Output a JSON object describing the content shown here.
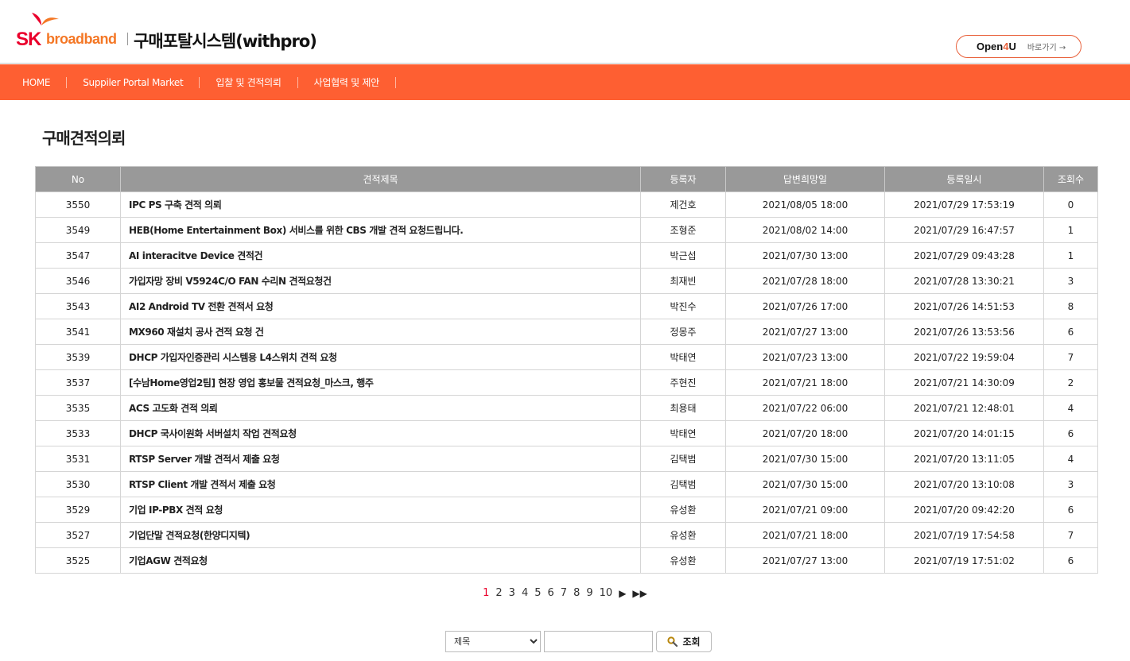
{
  "header": {
    "logo_sk": "SK",
    "logo_broadband": "broadband",
    "site_title": "구매포탈시스템(withpro)",
    "open4u_prefix": "Open",
    "open4u_num": "4",
    "open4u_suffix": "U",
    "open4u_go": "바로가기 →"
  },
  "nav": [
    {
      "label": "HOME"
    },
    {
      "label": "Suppiler Portal Market"
    },
    {
      "label": "입찰 및 견적의뢰"
    },
    {
      "label": "사업협력 및 제안"
    }
  ],
  "page_title": "구매견적의뢰",
  "table": {
    "headers": [
      "No",
      "견적제목",
      "등록자",
      "답변희망일",
      "등록일시",
      "조회수"
    ],
    "rows": [
      [
        "3550",
        "IPC PS 구축 견적 의뢰",
        "제건호",
        "2021/08/05 18:00",
        "2021/07/29 17:53:19",
        "0"
      ],
      [
        "3549",
        "HEB(Home Entertainment Box) 서비스를 위한 CBS 개발 견적 요청드립니다.",
        "조형준",
        "2021/08/02 14:00",
        "2021/07/29 16:47:57",
        "1"
      ],
      [
        "3547",
        "AI interacitve Device 견적건",
        "박근섭",
        "2021/07/30 13:00",
        "2021/07/29 09:43:28",
        "1"
      ],
      [
        "3546",
        "가입자망 장비 V5924C/O FAN 수리N 견적요청건",
        "최재빈",
        "2021/07/28 18:00",
        "2021/07/28 13:30:21",
        "3"
      ],
      [
        "3543",
        "AI2 Android TV 전환 견적서 요청",
        "박진수",
        "2021/07/26 17:00",
        "2021/07/26 14:51:53",
        "8"
      ],
      [
        "3541",
        "MX960 재설치 공사 견적 요청 건",
        "정몽주",
        "2021/07/27 13:00",
        "2021/07/26 13:53:56",
        "6"
      ],
      [
        "3539",
        "DHCP 가입자인증관리 시스템용 L4스위치 견적 요청",
        "박태연",
        "2021/07/23 13:00",
        "2021/07/22 19:59:04",
        "7"
      ],
      [
        "3537",
        "[수남Home영업2팀] 현장 영업 홍보물 견적요청_마스크, 행주",
        "주현진",
        "2021/07/21 18:00",
        "2021/07/21 14:30:09",
        "2"
      ],
      [
        "3535",
        "ACS 고도화 견적 의뢰",
        "최용태",
        "2021/07/22 06:00",
        "2021/07/21 12:48:01",
        "4"
      ],
      [
        "3533",
        "DHCP 국사이원화 서버설치 작업 견적요청",
        "박태연",
        "2021/07/20 18:00",
        "2021/07/20 14:01:15",
        "6"
      ],
      [
        "3531",
        "RTSP Server 개발 견적서 제출 요청",
        "김택범",
        "2021/07/30 15:00",
        "2021/07/20 13:11:05",
        "4"
      ],
      [
        "3530",
        "RTSP Client 개발 견적서 제출 요청",
        "김택범",
        "2021/07/30 15:00",
        "2021/07/20 13:10:08",
        "3"
      ],
      [
        "3529",
        "기업 IP-PBX 견적 요청",
        "유성환",
        "2021/07/21 09:00",
        "2021/07/20 09:42:20",
        "6"
      ],
      [
        "3527",
        "기업단말 견적요청(한양디지텍)",
        "유성환",
        "2021/07/21 18:00",
        "2021/07/19 17:54:58",
        "7"
      ],
      [
        "3525",
        "기업AGW 견적요청",
        "유성환",
        "2021/07/27 13:00",
        "2021/07/19 17:51:02",
        "6"
      ]
    ]
  },
  "pagination": {
    "pages": [
      "1",
      "2",
      "3",
      "4",
      "5",
      "6",
      "7",
      "8",
      "9",
      "10"
    ],
    "current": "1",
    "next": "▶",
    "last": "▶▶"
  },
  "search": {
    "selected_option": "제목",
    "input_value": "",
    "button_label": "조회"
  },
  "colors": {
    "nav_bg": "#fe5f32",
    "header_bg": "#999999",
    "brand_red": "#ea002c",
    "brand_orange": "#f47725"
  },
  "icons": [
    "sk-butterfly-logo",
    "search-icon"
  ]
}
